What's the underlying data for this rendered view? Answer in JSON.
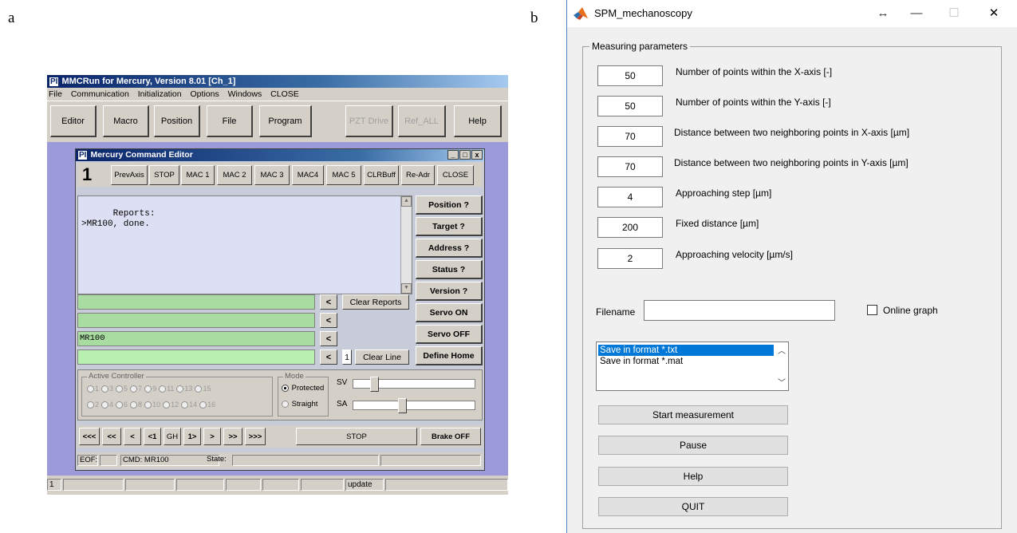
{
  "panel_labels": {
    "a": "a",
    "b": "b"
  },
  "mmcrun": {
    "title": "MMCRun for Mercury, Version 8.01 [Ch_1]",
    "logo_text": "PI",
    "menu": [
      "File",
      "Communication",
      "Initialization",
      "Options",
      "Windows",
      "CLOSE"
    ],
    "toolbar": {
      "editor": "Editor",
      "macro": "Macro",
      "position": "Position",
      "file": "File",
      "program": "Program",
      "pzt_drive": "PZT Drive",
      "ref_all": "Ref_ALL",
      "help": "Help"
    },
    "statusbar": {
      "first": "1",
      "update": "update"
    },
    "editor": {
      "title": "Mercury Command Editor",
      "window_buttons": [
        "_",
        "□",
        "x"
      ],
      "axis_number": "1",
      "cmd_buttons": [
        "PrevAxis",
        "STOP",
        "MAC 1",
        "MAC 2",
        "MAC 3",
        "MAC4",
        "MAC 5",
        "CLRBuff",
        "Re-Adr",
        "CLOSE"
      ],
      "reports_text": "Reports:\n>MR100, done.",
      "side_buttons": [
        "Position ?",
        "Target ?",
        "Address ?",
        "Status ?",
        "Version ?",
        "Servo ON",
        "Servo OFF",
        "Define Home"
      ],
      "clear_reports": "Clear Reports",
      "arrow_label": "<",
      "command_lines": [
        "",
        "",
        "MR100",
        ""
      ],
      "line_number": "1",
      "clear_line": "Clear Line",
      "active_controller_label": "Active Controller",
      "controllers_row1": [
        "1",
        "3",
        "5",
        "7",
        "9",
        "11",
        "13",
        "15"
      ],
      "controllers_row2": [
        "2",
        "4",
        "6",
        "8",
        "10",
        "12",
        "14",
        "16"
      ],
      "mode_label": "Mode",
      "mode_protected": "Protected",
      "mode_straight": "Straight",
      "sv_label": "SV",
      "sa_label": "SA",
      "sv_level": 0.15,
      "sa_level": 0.4,
      "nav_buttons": [
        "<<<",
        "<<",
        "<",
        "<1",
        "GH",
        "1>",
        ">",
        ">>",
        ">>>"
      ],
      "stop_label": "STOP",
      "brake_off": "Brake OFF",
      "eof_label": "EOF:",
      "cmd_label": "CMD:",
      "cmd_value": "MR100",
      "state_label": "State:"
    }
  },
  "spm": {
    "title": "SPM_mechanoscopy",
    "window_controls": {
      "move": "↔",
      "minimize": "—",
      "maximize": "☐",
      "close": "✕"
    },
    "group_label": "Measuring parameters",
    "params": [
      {
        "value": "50",
        "label": "Number of points within the X-axis [-]"
      },
      {
        "value": "50",
        "label": "Number of points within the Y-axis [-]"
      },
      {
        "value": "70",
        "label": "Distance between two neighboring points in X-axis [µm]"
      },
      {
        "value": "70",
        "label": "Distance between two neighboring points in Y-axis [µm]"
      },
      {
        "value": "4",
        "label": "Approaching step [µm]"
      },
      {
        "value": "200",
        "label": "Fixed distance [µm]"
      },
      {
        "value": "2",
        "label": "Approaching velocity [µm/s]"
      }
    ],
    "filename_label": "Filename",
    "filename_value": "",
    "online_graph_label": "Online graph",
    "save_formats": [
      "Save in format *.txt",
      "Save in format *.mat"
    ],
    "buttons": {
      "start": "Start measurement",
      "pause": "Pause",
      "help": "Help",
      "quit": "QUIT"
    },
    "colors": {
      "selection": "#0078d7",
      "logo": "#e8701a"
    }
  }
}
